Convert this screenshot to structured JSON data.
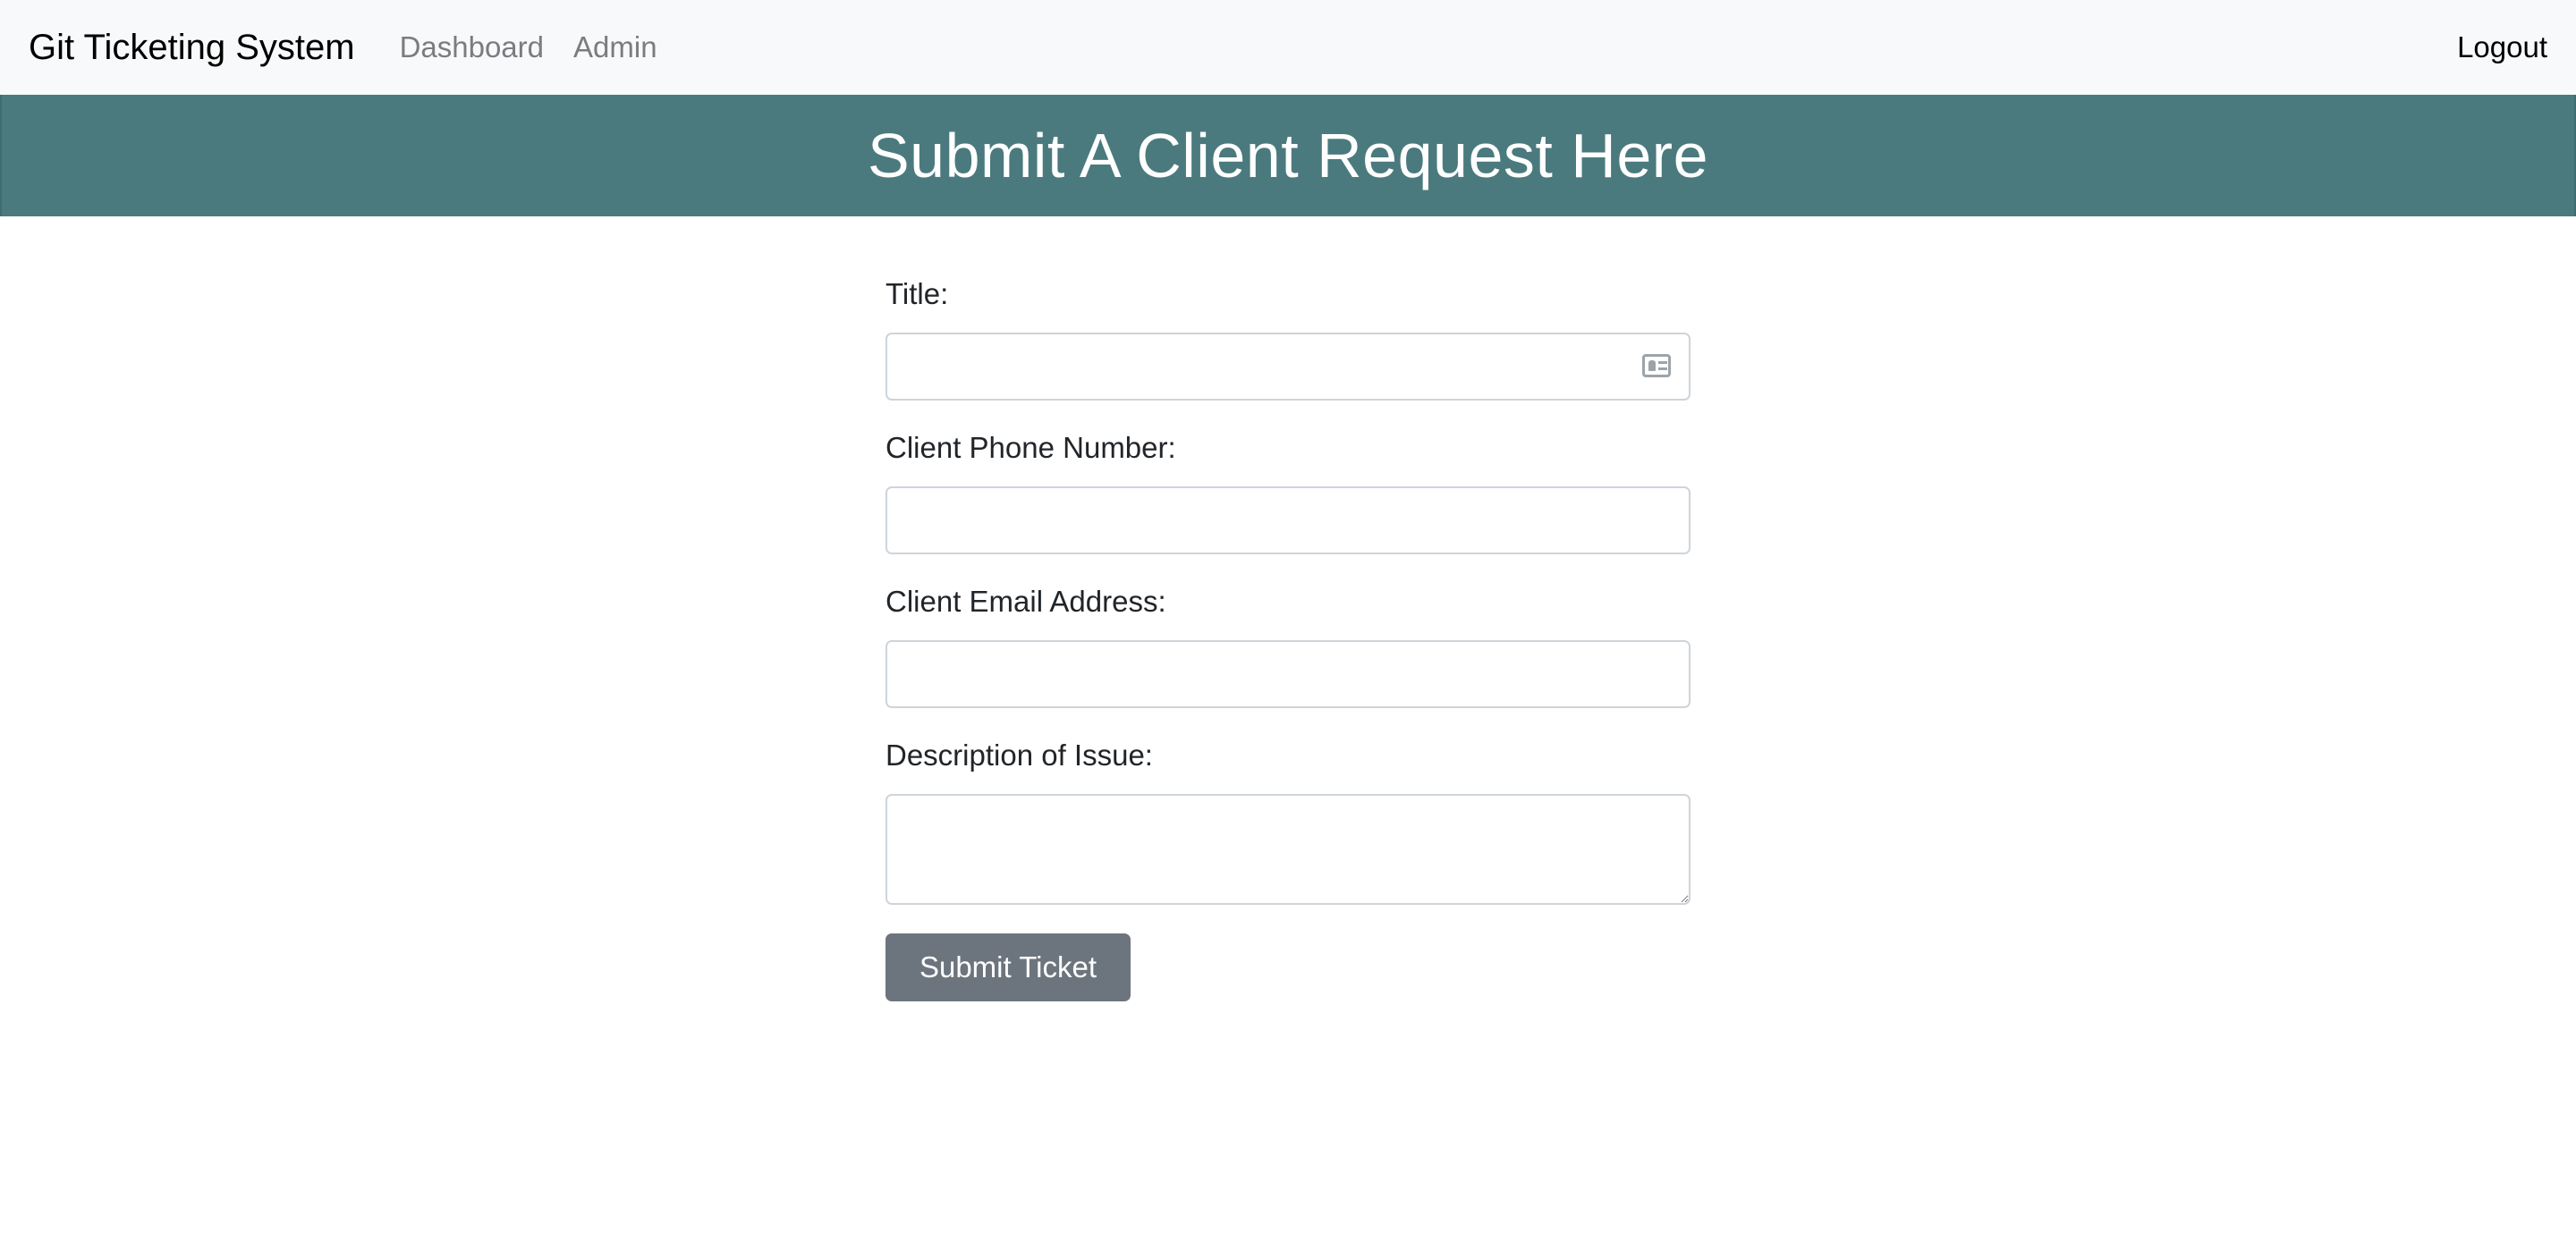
{
  "navbar": {
    "brand": "Git Ticketing System",
    "links": [
      "Dashboard",
      "Admin"
    ],
    "logout": "Logout"
  },
  "banner": {
    "title": "Submit A Client Request Here",
    "background": "#4a7a7e"
  },
  "form": {
    "fields": [
      {
        "label": "Title:",
        "value": "",
        "placeholder": "",
        "icon": "contact-card-icon"
      },
      {
        "label": "Client Phone Number:",
        "value": "",
        "placeholder": ""
      },
      {
        "label": "Client Email Address:",
        "value": "",
        "placeholder": ""
      },
      {
        "label": "Description of Issue:",
        "value": "",
        "placeholder": ""
      }
    ],
    "submit_label": "Submit Ticket",
    "submit_color": "#6c757d"
  }
}
